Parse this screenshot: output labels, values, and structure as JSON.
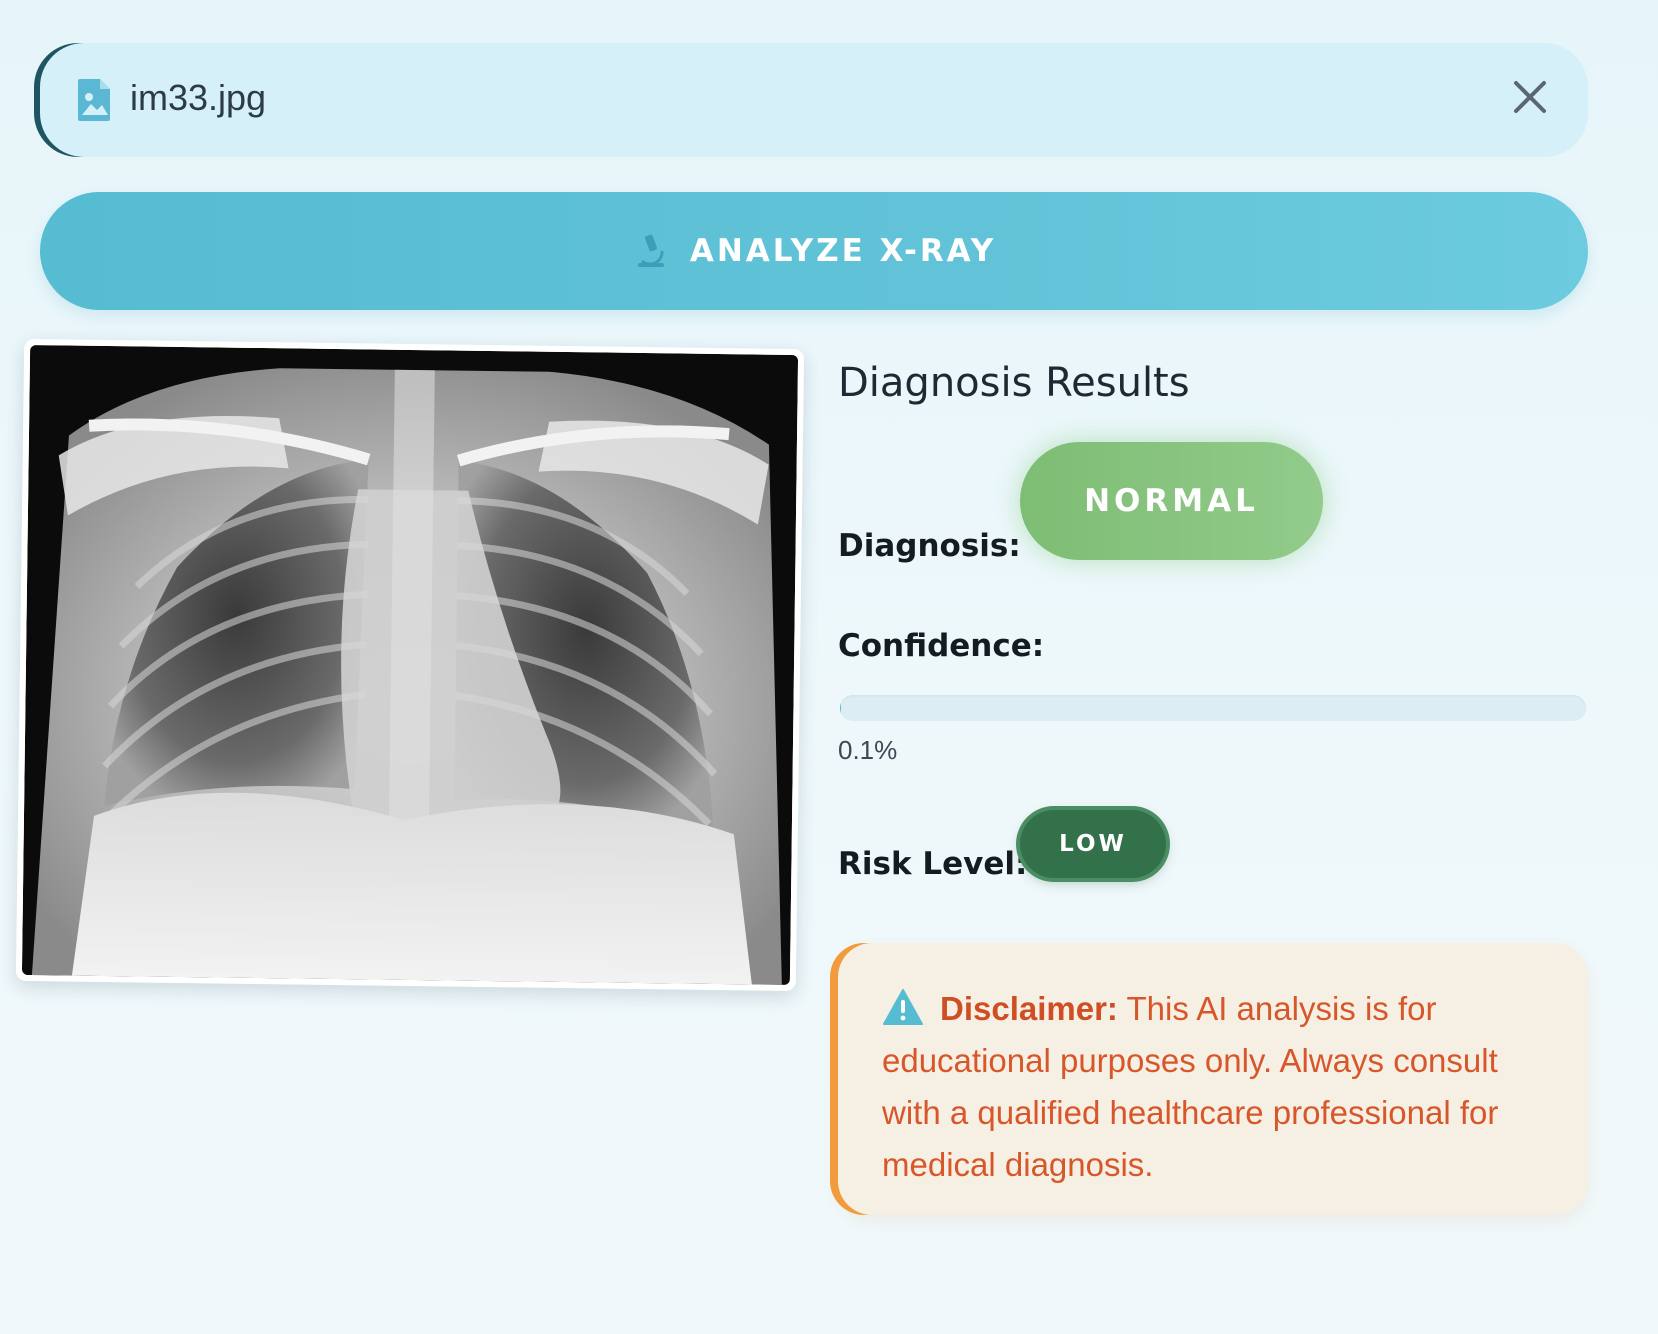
{
  "file": {
    "name": "im33.jpg",
    "icon": "image-file-icon",
    "close_icon": "close-icon"
  },
  "analyze_button": {
    "label": "ANALYZE X-RAY",
    "icon": "microscope-icon"
  },
  "xray_image": {
    "description_icon": "chest-xray-image"
  },
  "results": {
    "title": "Diagnosis Results",
    "diagnosis_label": "Diagnosis:",
    "diagnosis_value": "NORMAL",
    "confidence_label": "Confidence:",
    "confidence_text": "0.1%",
    "confidence_fraction": 0.001,
    "risk_label": "Risk Level:",
    "risk_value": "LOW"
  },
  "disclaimer": {
    "icon": "warning-icon",
    "title": "Disclaimer:",
    "text": " This AI analysis is for educational purposes only. Always consult with a qualified healthcare professional for medical diagnosis."
  },
  "colors": {
    "accent": "#55bcd2",
    "normal_badge": "#86c47d",
    "risk_low_badge": "#32714a",
    "disclaimer_text": "#d8572a",
    "disclaimer_border": "#f19b3c"
  }
}
